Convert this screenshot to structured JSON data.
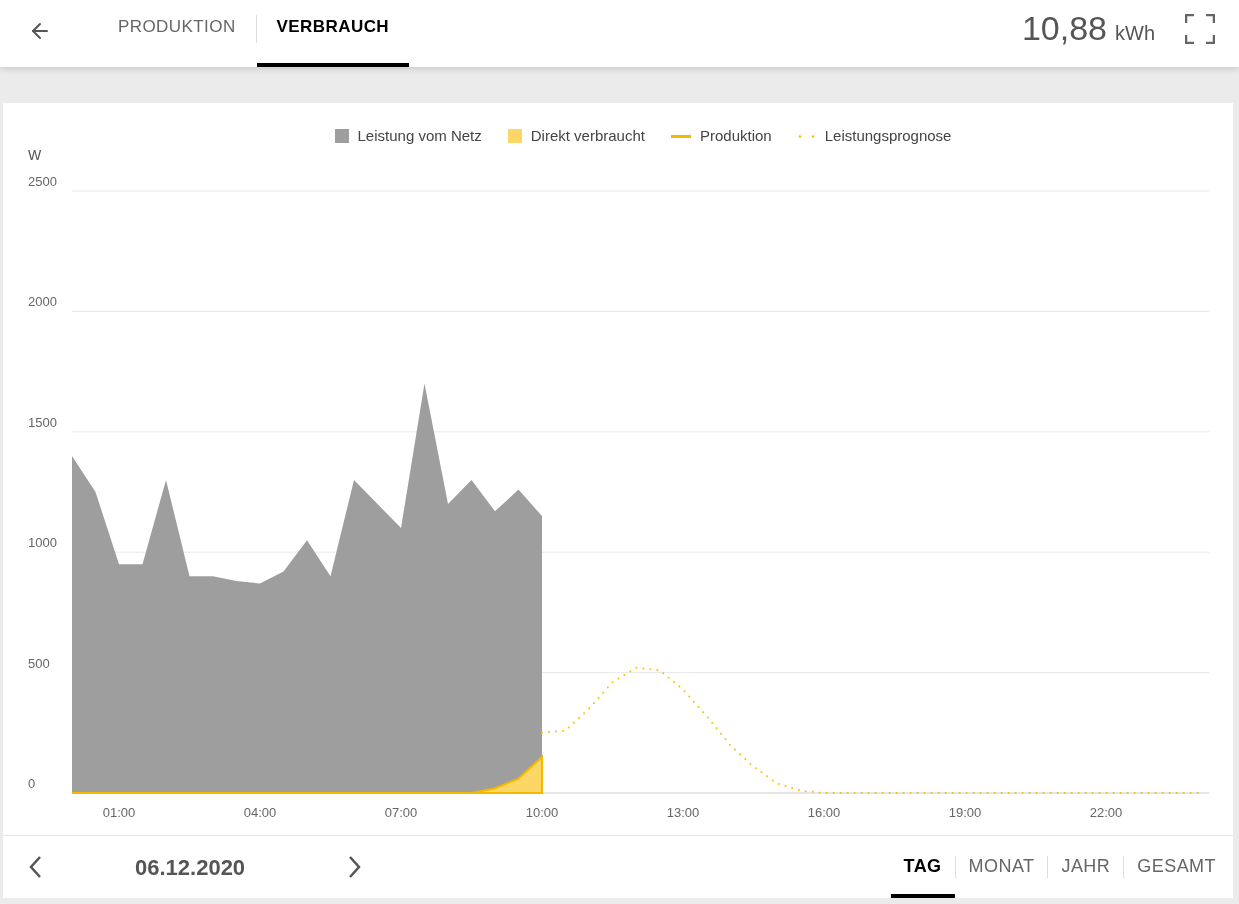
{
  "header": {
    "tabs": [
      {
        "label": "PRODUKTION",
        "selected": false
      },
      {
        "label": "VERBRAUCH",
        "selected": true
      }
    ],
    "total": {
      "value": "10,88",
      "unit": "kWh"
    }
  },
  "chart": {
    "production_line": {
      "label": "Produktion",
      "color": "#f5b800"
    },
    "chart_data": {
      "type": "area",
      "ylabel": "W",
      "x": [
        0,
        0.5,
        1,
        1.5,
        2,
        2.5,
        3,
        3.5,
        4,
        4.5,
        5,
        5.5,
        6,
        6.5,
        7,
        7.5,
        8,
        8.5,
        9,
        9.5,
        10,
        10.5,
        11,
        11.5,
        12,
        12.5,
        13,
        13.5,
        14,
        14.5,
        15,
        15.5,
        16,
        16.5,
        17,
        17.5,
        18,
        18.5,
        19,
        19.5,
        20,
        20.5,
        21,
        21.5,
        22,
        22.5,
        23,
        23.5,
        24
      ],
      "xlim": [
        0,
        24.2
      ],
      "ylim": [
        0,
        2500
      ],
      "xticks": [
        {
          "value": 1,
          "label": "01:00"
        },
        {
          "value": 4,
          "label": "04:00"
        },
        {
          "value": 7,
          "label": "07:00"
        },
        {
          "value": 10,
          "label": "10:00"
        },
        {
          "value": 13,
          "label": "13:00"
        },
        {
          "value": 16,
          "label": "16:00"
        },
        {
          "value": 19,
          "label": "19:00"
        },
        {
          "value": 22,
          "label": "22:00"
        }
      ],
      "yticks": [
        0,
        500,
        1000,
        1500,
        2000,
        2500
      ],
      "stacked": true,
      "grid": true,
      "series": [
        {
          "name": "Leistung vom Netz",
          "type": "area",
          "color": "#9e9e9e",
          "values": [
            1400,
            1250,
            950,
            950,
            1300,
            900,
            900,
            880,
            870,
            920,
            1050,
            900,
            1300,
            1200,
            1100,
            1700,
            1200,
            1300,
            1150,
            1200,
            1000,
            null,
            null,
            null,
            null,
            null,
            null,
            null,
            null,
            null,
            null,
            null,
            null,
            null,
            null,
            null,
            null,
            null,
            null,
            null,
            null,
            null,
            null,
            null,
            null,
            null,
            null,
            null,
            null
          ]
        },
        {
          "name": "Direkt verbraucht",
          "type": "area",
          "color": "#fdd765",
          "values": [
            0,
            0,
            0,
            0,
            0,
            0,
            0,
            0,
            0,
            0,
            0,
            0,
            0,
            0,
            0,
            0,
            0,
            0,
            20,
            60,
            150,
            null,
            null,
            null,
            null,
            null,
            null,
            null,
            null,
            null,
            null,
            null,
            null,
            null,
            null,
            null,
            null,
            null,
            null,
            null,
            null,
            null,
            null,
            null,
            null,
            null,
            null,
            null,
            null
          ]
        },
        {
          "name": "Leistungsprognose",
          "type": "line",
          "line_style": "dotted",
          "color": "#f5c000",
          "values": [
            null,
            null,
            null,
            null,
            null,
            null,
            null,
            null,
            null,
            null,
            null,
            null,
            null,
            null,
            null,
            null,
            null,
            null,
            null,
            null,
            250,
            260,
            350,
            460,
            520,
            510,
            430,
            320,
            200,
            110,
            40,
            10,
            0,
            0,
            0,
            0,
            0,
            0,
            0,
            0,
            0,
            0,
            0,
            0,
            0,
            0,
            0,
            0,
            0
          ]
        }
      ]
    }
  },
  "footer": {
    "date": "06.12.2020",
    "ranges": [
      {
        "label": "TAG",
        "selected": true
      },
      {
        "label": "MONAT",
        "selected": false
      },
      {
        "label": "JAHR",
        "selected": false
      },
      {
        "label": "GESAMT",
        "selected": false
      }
    ]
  }
}
